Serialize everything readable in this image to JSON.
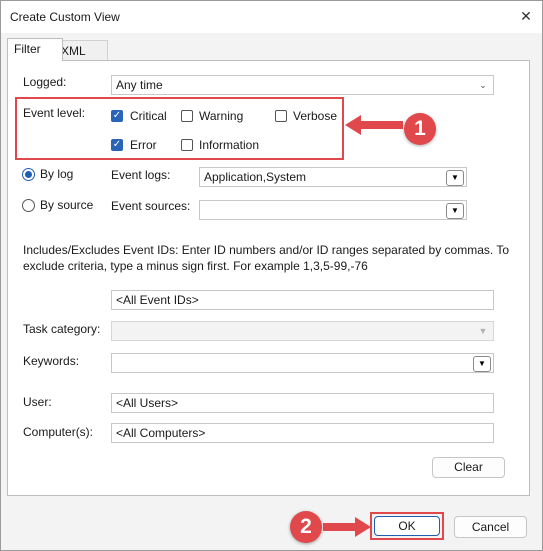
{
  "window": {
    "title": "Create Custom View"
  },
  "tabs": [
    {
      "label": "Filter"
    },
    {
      "label": "XML"
    }
  ],
  "filter": {
    "logged": {
      "label": "Logged:",
      "value": "Any time"
    },
    "event_level": {
      "label": "Event level:",
      "options": [
        {
          "label": "Critical",
          "checked": true
        },
        {
          "label": "Warning",
          "checked": false
        },
        {
          "label": "Verbose",
          "checked": false
        },
        {
          "label": "Error",
          "checked": true
        },
        {
          "label": "Information",
          "checked": false
        }
      ]
    },
    "by_log": {
      "label": "By log",
      "selected": true
    },
    "by_source": {
      "label": "By source",
      "selected": false
    },
    "event_logs": {
      "label": "Event logs:",
      "value": "Application,System"
    },
    "event_sources": {
      "label": "Event sources:",
      "value": ""
    },
    "description": "Includes/Excludes Event IDs: Enter ID numbers and/or ID ranges separated by commas. To exclude criteria, type a minus sign first. For example 1,3,5-99,-76",
    "event_ids": {
      "value": "<All Event IDs>"
    },
    "task_category": {
      "label": "Task category:",
      "value": ""
    },
    "keywords": {
      "label": "Keywords:",
      "value": ""
    },
    "user": {
      "label": "User:",
      "value": "<All Users>"
    },
    "computer": {
      "label": "Computer(s):",
      "value": "<All Computers>"
    },
    "clear_label": "Clear"
  },
  "buttons": {
    "ok": "OK",
    "cancel": "Cancel"
  },
  "annotations": {
    "badge1": "1",
    "badge2": "2",
    "color": "#e0484b"
  }
}
